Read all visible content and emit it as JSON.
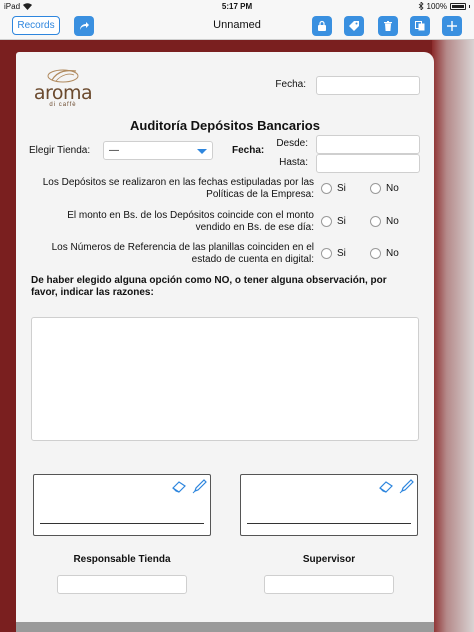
{
  "status_bar": {
    "device": "iPad",
    "time": "5:17 PM",
    "battery": "100%"
  },
  "toolbar": {
    "records_label": "Records",
    "title": "Unnamed"
  },
  "logo": {
    "brand": "aroma",
    "sub": "di caffè"
  },
  "form": {
    "fecha_label": "Fecha:",
    "fecha_value": "",
    "title": "Auditoría Depósitos Bancarios",
    "tienda_label": "Elegir Tienda:",
    "tienda_value": "—",
    "fecha_range_label": "Fecha:",
    "desde_label": "Desde:",
    "hasta_label": "Hasta:",
    "desde_value": "",
    "hasta_value": "",
    "questions": [
      {
        "line1": "Los Depósitos se realizaron en las fechas estipuladas por las",
        "line2": "Políticas de la Empresa:",
        "yes": "Si",
        "no": "No"
      },
      {
        "line1": "El monto en Bs. de los Depósitos coincide con el monto",
        "line2": "vendido en Bs. de ese día:",
        "yes": "Si",
        "no": "No"
      },
      {
        "line1": "Los Números de Referencia de las planillas coinciden en el",
        "line2": "estado de cuenta en digital:",
        "yes": "Si",
        "no": "No"
      }
    ],
    "observation_line1": "De haber elegido alguna opción como NO, o tener alguna observación, por",
    "observation_line2": "favor, indicar las razones:",
    "observation_value": "",
    "signatures": [
      {
        "label": "Responsable Tienda",
        "value": ""
      },
      {
        "label": "Supervisor",
        "value": ""
      }
    ]
  },
  "colors": {
    "accent": "#2e86de",
    "frame": "#7a1f1f",
    "paper": "#f4f4f4"
  }
}
